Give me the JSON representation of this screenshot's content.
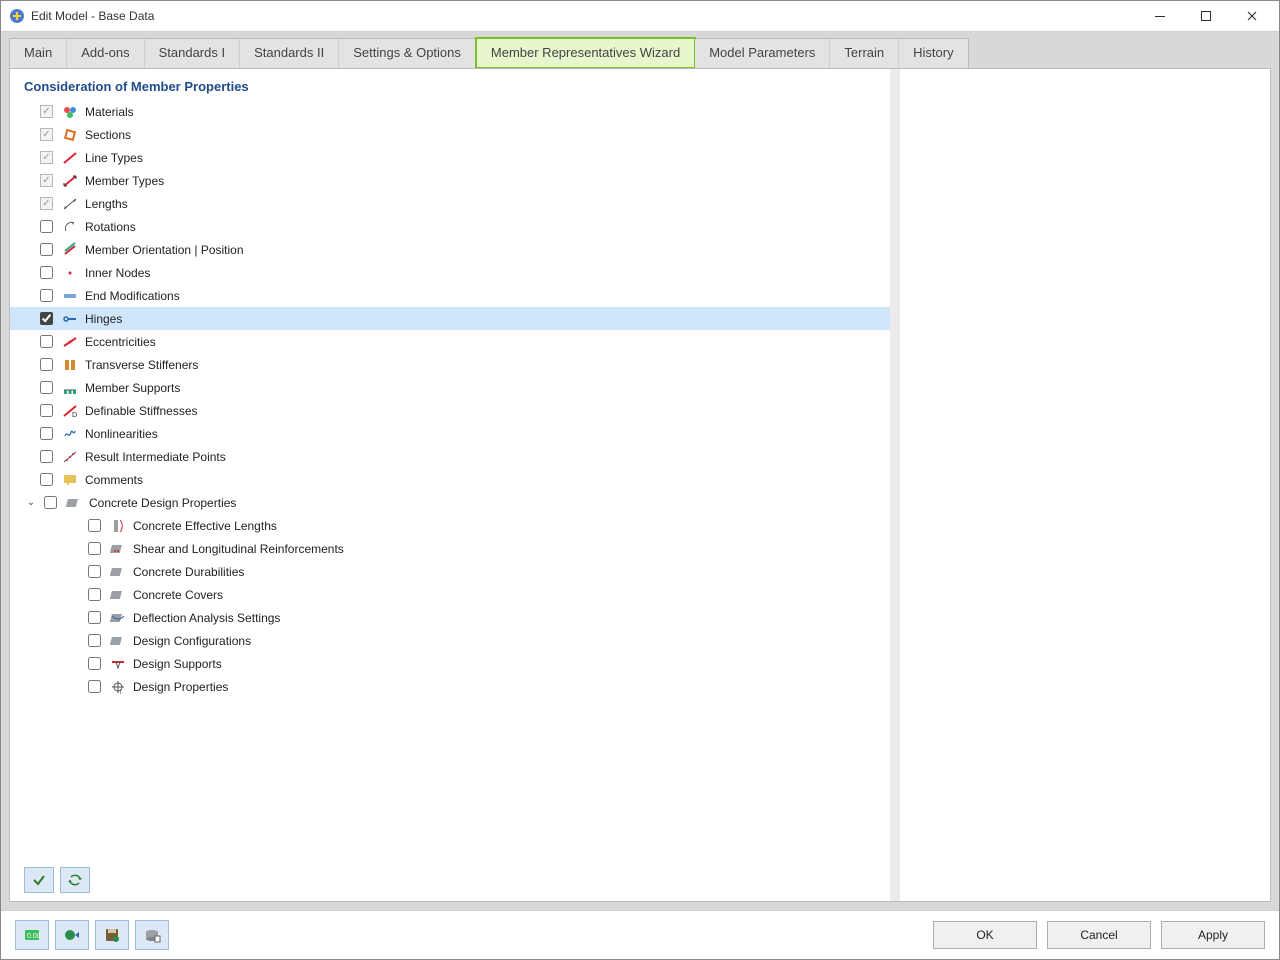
{
  "window": {
    "title": "Edit Model - Base Data"
  },
  "tabs": [
    {
      "label": "Main"
    },
    {
      "label": "Add-ons"
    },
    {
      "label": "Standards I"
    },
    {
      "label": "Standards II"
    },
    {
      "label": "Settings & Options"
    },
    {
      "label": "Member Representatives Wizard",
      "highlight": true
    },
    {
      "label": "Model Parameters"
    },
    {
      "label": "Terrain"
    },
    {
      "label": "History"
    }
  ],
  "section_heading": "Consideration of Member Properties",
  "items": [
    {
      "label": "Materials",
      "state": "locked_checked",
      "icon": "materials-icon"
    },
    {
      "label": "Sections",
      "state": "locked_checked",
      "icon": "sections-icon"
    },
    {
      "label": "Line Types",
      "state": "locked_checked",
      "icon": "line-types-icon"
    },
    {
      "label": "Member Types",
      "state": "locked_checked",
      "icon": "member-types-icon"
    },
    {
      "label": "Lengths",
      "state": "locked_checked",
      "icon": "lengths-icon"
    },
    {
      "label": "Rotations",
      "state": "unchecked",
      "icon": "rotations-icon"
    },
    {
      "label": "Member Orientation | Position",
      "state": "unchecked",
      "icon": "orientation-icon"
    },
    {
      "label": "Inner Nodes",
      "state": "unchecked",
      "icon": "inner-nodes-icon"
    },
    {
      "label": "End Modifications",
      "state": "unchecked",
      "icon": "end-mod-icon"
    },
    {
      "label": "Hinges",
      "state": "checked",
      "icon": "hinges-icon",
      "selected": true
    },
    {
      "label": "Eccentricities",
      "state": "unchecked",
      "icon": "eccentricities-icon"
    },
    {
      "label": "Transverse Stiffeners",
      "state": "unchecked",
      "icon": "stiffeners-icon"
    },
    {
      "label": "Member Supports",
      "state": "unchecked",
      "icon": "supports-icon"
    },
    {
      "label": "Definable Stiffnesses",
      "state": "unchecked",
      "icon": "stiffness-icon"
    },
    {
      "label": "Nonlinearities",
      "state": "unchecked",
      "icon": "nonlinear-icon"
    },
    {
      "label": "Result Intermediate Points",
      "state": "unchecked",
      "icon": "result-points-icon"
    },
    {
      "label": "Comments",
      "state": "unchecked",
      "icon": "comments-icon"
    },
    {
      "label": "Concrete Design Properties",
      "state": "unchecked",
      "icon": "concrete-group-icon",
      "expandable": true,
      "children": [
        {
          "label": "Concrete Effective Lengths",
          "state": "unchecked",
          "icon": "concrete-length-icon"
        },
        {
          "label": "Shear and Longitudinal Reinforcements",
          "state": "unchecked",
          "icon": "reinforcement-icon"
        },
        {
          "label": "Concrete Durabilities",
          "state": "unchecked",
          "icon": "durability-icon"
        },
        {
          "label": "Concrete Covers",
          "state": "unchecked",
          "icon": "covers-icon"
        },
        {
          "label": "Deflection Analysis Settings",
          "state": "unchecked",
          "icon": "deflection-icon"
        },
        {
          "label": "Design Configurations",
          "state": "unchecked",
          "icon": "design-config-icon"
        },
        {
          "label": "Design Supports",
          "state": "unchecked",
          "icon": "design-supports-icon"
        },
        {
          "label": "Design Properties",
          "state": "unchecked",
          "icon": "design-props-icon"
        }
      ]
    }
  ],
  "tool_buttons": [
    {
      "name": "check-all-button"
    },
    {
      "name": "reset-selection-button"
    }
  ],
  "footer_tools": [
    {
      "name": "units-button"
    },
    {
      "name": "export-button"
    },
    {
      "name": "save-settings-button"
    },
    {
      "name": "database-button"
    }
  ],
  "actions": {
    "ok": "OK",
    "cancel": "Cancel",
    "apply": "Apply"
  }
}
